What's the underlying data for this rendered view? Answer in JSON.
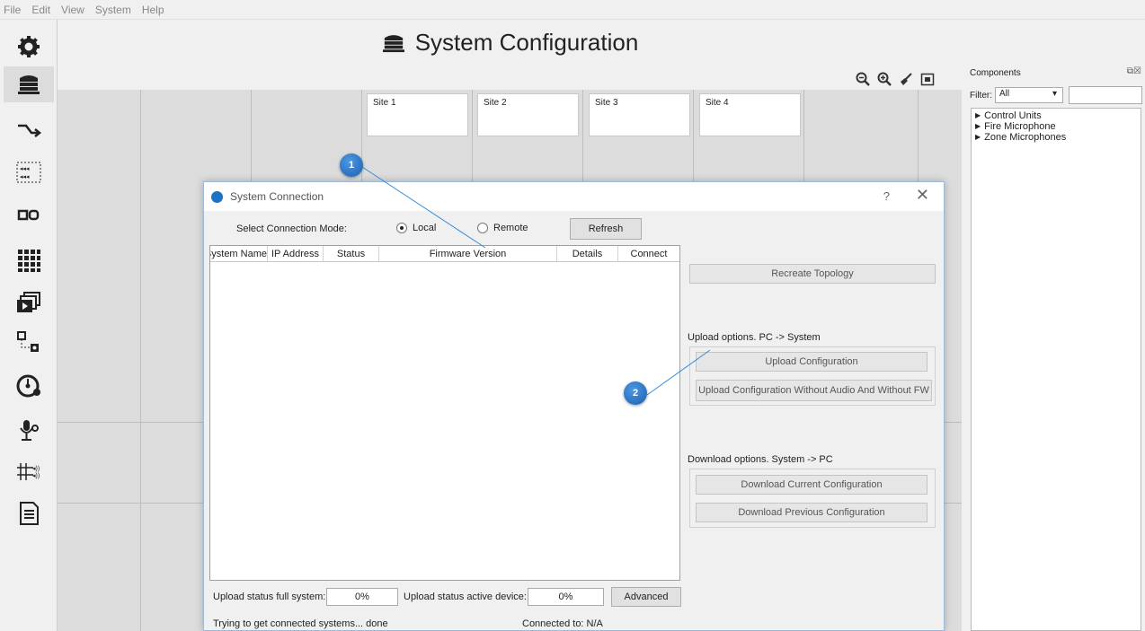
{
  "menu": [
    "File",
    "Edit",
    "View",
    "System",
    "Help"
  ],
  "title": "System Configuration",
  "sites": [
    "Site 1",
    "Site 2",
    "Site 3",
    "Site 4"
  ],
  "components": {
    "header": "Components",
    "filter_label": "Filter:",
    "filter_value": "All",
    "tree": [
      "Control Units",
      "Fire Microphone",
      "Zone Microphones"
    ]
  },
  "dialog": {
    "title": "System Connection",
    "help": "?",
    "close": "✕",
    "mode_label": "Select Connection Mode:",
    "mode_local": "Local",
    "mode_remote": "Remote",
    "refresh": "Refresh",
    "columns": [
      "System Name",
      "IP Address",
      "Status",
      "Firmware Version",
      "Details",
      "Connect"
    ],
    "recreate": "Recreate Topology",
    "upload_label": "Upload options. PC -> System",
    "upload_config": "Upload Configuration",
    "upload_no_audio": "Upload Configuration Without Audio And Without FW",
    "download_label": "Download options. System -> PC",
    "download_current": "Download Current Configuration",
    "download_previous": "Download Previous Configuration",
    "upload_full_label": "Upload status full system:",
    "upload_full_pct": "0%",
    "upload_active_label": "Upload status active device:",
    "upload_active_pct": "0%",
    "advanced": "Advanced",
    "status_text": "Trying to get connected systems... done",
    "connected_to": "Connected to: N/A"
  },
  "callouts": [
    "1",
    "2"
  ]
}
